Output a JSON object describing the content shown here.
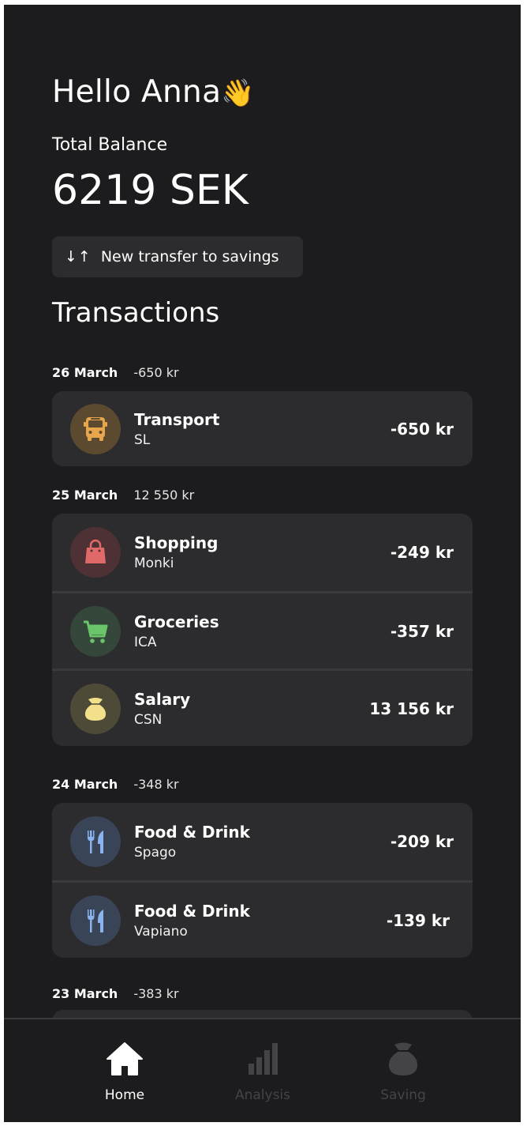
{
  "greeting": {
    "text": "Hello Anna",
    "emoji": "👋"
  },
  "balance": {
    "label": "Total Balance",
    "value": "6219 SEK"
  },
  "transfer_button": {
    "arrows": "↓↑",
    "label": "New transfer to savings"
  },
  "transactions_title": "Transactions",
  "days": [
    {
      "date": "26 March",
      "total": "-650 kr",
      "items": [
        {
          "category": "Transport",
          "merchant": "SL",
          "amount": "-650 kr",
          "icon": "bus-icon",
          "color": "#e8a64c"
        }
      ]
    },
    {
      "date": "25 March",
      "total": "12 550 kr",
      "items": [
        {
          "category": "Shopping",
          "merchant": "Monki",
          "amount": "-249 kr",
          "icon": "shopping-bag-icon",
          "color": "#e06a6a"
        },
        {
          "category": "Groceries",
          "merchant": "ICA",
          "amount": "-357 kr",
          "icon": "cart-icon",
          "color": "#6ac46a"
        },
        {
          "category": "Salary",
          "merchant": "CSN",
          "amount": "13 156 kr",
          "icon": "money-bag-icon",
          "color": "#f2e08a"
        }
      ]
    },
    {
      "date": "24 March",
      "total": "-348 kr",
      "items": [
        {
          "category": "Food & Drink",
          "merchant": "Spago",
          "amount": "-209 kr",
          "icon": "cutlery-icon",
          "color": "#8ab4ef"
        },
        {
          "category": "Food & Drink",
          "merchant": "Vapiano",
          "amount": "-139 kr",
          "icon": "cutlery-icon",
          "color": "#8ab4ef"
        }
      ]
    },
    {
      "date": "23 March",
      "total": "-383 kr",
      "items": []
    }
  ],
  "nav": [
    {
      "label": "Home",
      "icon": "home-icon",
      "active": true
    },
    {
      "label": "Analysis",
      "icon": "bar-chart-icon",
      "active": false
    },
    {
      "label": "Saving",
      "icon": "money-bag-icon",
      "active": false
    }
  ]
}
